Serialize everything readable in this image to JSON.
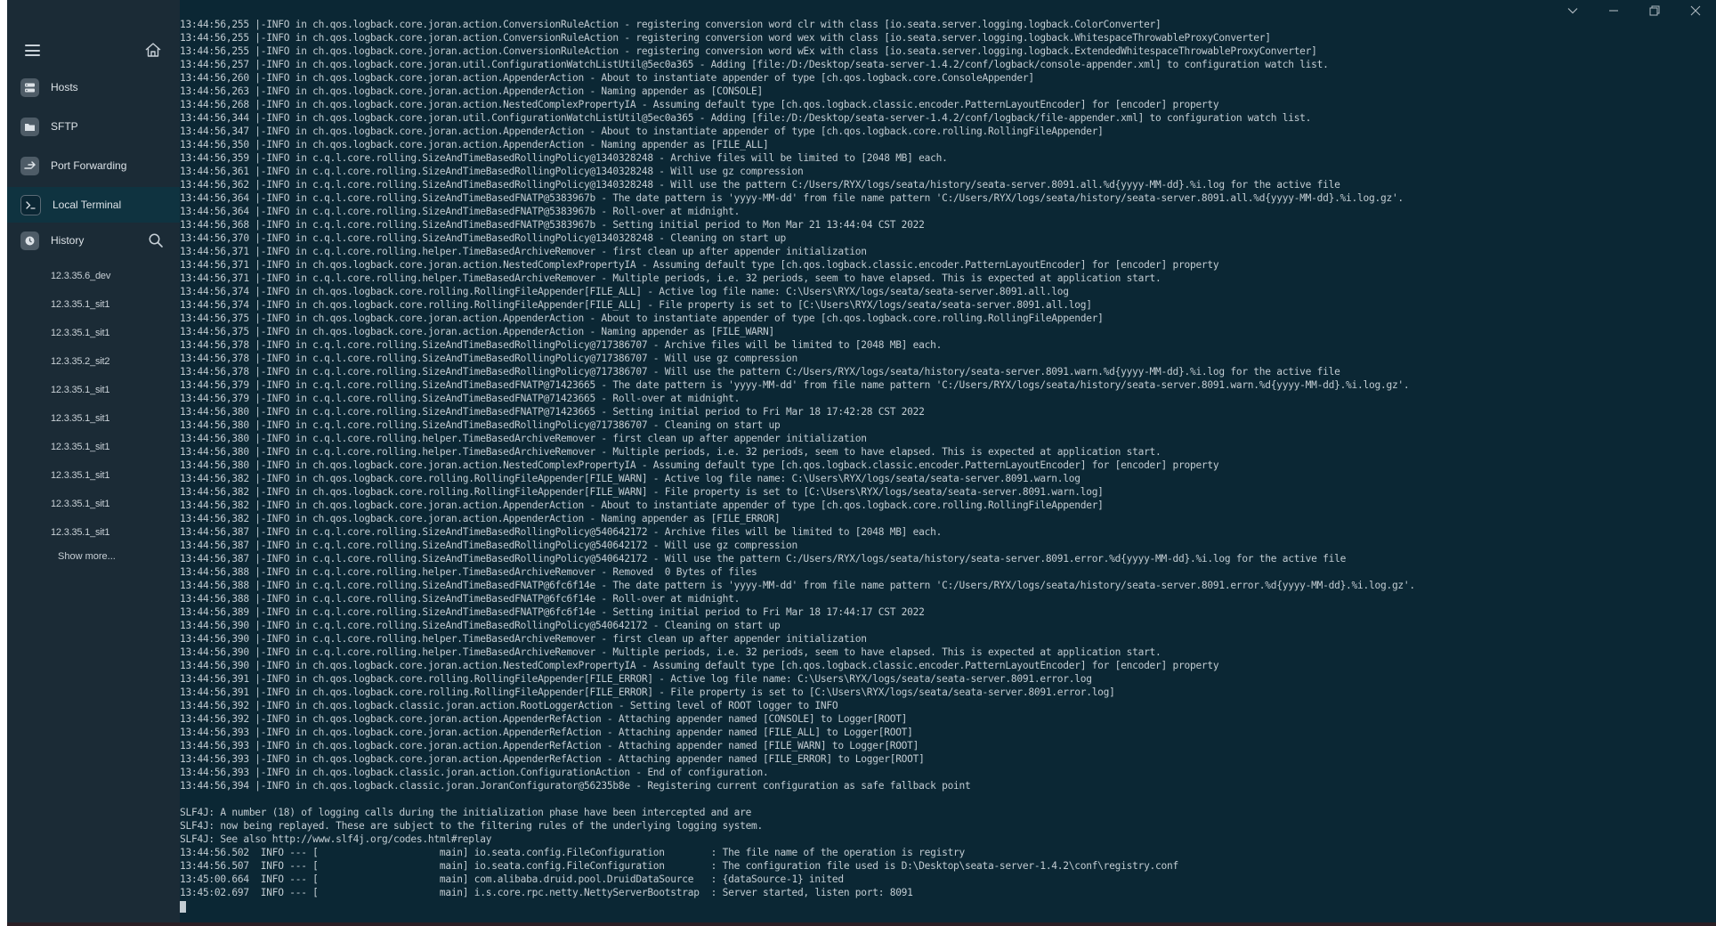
{
  "sidebar": {
    "nav": [
      {
        "label": "Hosts",
        "icon": "hosts-icon"
      },
      {
        "label": "SFTP",
        "icon": "sftp-icon"
      },
      {
        "label": "Port Forwarding",
        "icon": "port-forwarding-icon"
      },
      {
        "label": "Local Terminal",
        "icon": "terminal-icon"
      }
    ],
    "history_label": "History",
    "history": [
      "12.3.35.6_dev",
      "12.3.35.1_sit1",
      "12.3.35.1_sit1",
      "12.3.35.2_sit2",
      "12.3.35.1_sit1",
      "12.3.35.1_sit1",
      "12.3.35.1_sit1",
      "12.3.35.1_sit1",
      "12.3.35.1_sit1",
      "12.3.35.1_sit1"
    ],
    "show_more": "Show more..."
  },
  "window_controls": [
    "chevron-down-icon",
    "minimize-icon",
    "restore-icon",
    "close-icon"
  ],
  "terminal_lines": [
    "13:44:56,255 |-INFO in ch.qos.logback.core.joran.action.ConversionRuleAction - registering conversion word clr with class [io.seata.server.logging.logback.ColorConverter]",
    "13:44:56,255 |-INFO in ch.qos.logback.core.joran.action.ConversionRuleAction - registering conversion word wex with class [io.seata.server.logging.logback.WhitespaceThrowableProxyConverter]",
    "13:44:56,255 |-INFO in ch.qos.logback.core.joran.action.ConversionRuleAction - registering conversion word wEx with class [io.seata.server.logging.logback.ExtendedWhitespaceThrowableProxyConverter]",
    "13:44:56,257 |-INFO in ch.qos.logback.core.joran.util.ConfigurationWatchListUtil@5ec0a365 - Adding [file:/D:/Desktop/seata-server-1.4.2/conf/logback/console-appender.xml] to configuration watch list.",
    "13:44:56,260 |-INFO in ch.qos.logback.core.joran.action.AppenderAction - About to instantiate appender of type [ch.qos.logback.core.ConsoleAppender]",
    "13:44:56,263 |-INFO in ch.qos.logback.core.joran.action.AppenderAction - Naming appender as [CONSOLE]",
    "13:44:56,268 |-INFO in ch.qos.logback.core.joran.action.NestedComplexPropertyIA - Assuming default type [ch.qos.logback.classic.encoder.PatternLayoutEncoder] for [encoder] property",
    "13:44:56,344 |-INFO in ch.qos.logback.core.joran.util.ConfigurationWatchListUtil@5ec0a365 - Adding [file:/D:/Desktop/seata-server-1.4.2/conf/logback/file-appender.xml] to configuration watch list.",
    "13:44:56,347 |-INFO in ch.qos.logback.core.joran.action.AppenderAction - About to instantiate appender of type [ch.qos.logback.core.rolling.RollingFileAppender]",
    "13:44:56,350 |-INFO in ch.qos.logback.core.joran.action.AppenderAction - Naming appender as [FILE_ALL]",
    "13:44:56,359 |-INFO in c.q.l.core.rolling.SizeAndTimeBasedRollingPolicy@1340328248 - Archive files will be limited to [2048 MB] each.",
    "13:44:56,361 |-INFO in c.q.l.core.rolling.SizeAndTimeBasedRollingPolicy@1340328248 - Will use gz compression",
    "13:44:56,362 |-INFO in c.q.l.core.rolling.SizeAndTimeBasedRollingPolicy@1340328248 - Will use the pattern C:/Users/RYX/logs/seata/history/seata-server.8091.all.%d{yyyy-MM-dd}.%i.log for the active file",
    "13:44:56,364 |-INFO in c.q.l.core.rolling.SizeAndTimeBasedFNATP@5383967b - The date pattern is 'yyyy-MM-dd' from file name pattern 'C:/Users/RYX/logs/seata/history/seata-server.8091.all.%d{yyyy-MM-dd}.%i.log.gz'.",
    "13:44:56,364 |-INFO in c.q.l.core.rolling.SizeAndTimeBasedFNATP@5383967b - Roll-over at midnight.",
    "13:44:56,368 |-INFO in c.q.l.core.rolling.SizeAndTimeBasedFNATP@5383967b - Setting initial period to Mon Mar 21 13:44:04 CST 2022",
    "13:44:56,370 |-INFO in c.q.l.core.rolling.SizeAndTimeBasedRollingPolicy@1340328248 - Cleaning on start up",
    "13:44:56,371 |-INFO in c.q.l.core.rolling.helper.TimeBasedArchiveRemover - first clean up after appender initialization",
    "13:44:56,371 |-INFO in ch.qos.logback.core.joran.action.NestedComplexPropertyIA - Assuming default type [ch.qos.logback.classic.encoder.PatternLayoutEncoder] for [encoder] property",
    "13:44:56,371 |-INFO in c.q.l.core.rolling.helper.TimeBasedArchiveRemover - Multiple periods, i.e. 32 periods, seem to have elapsed. This is expected at application start.",
    "13:44:56,374 |-INFO in ch.qos.logback.core.rolling.RollingFileAppender[FILE_ALL] - Active log file name: C:\\Users\\RYX/logs/seata/seata-server.8091.all.log",
    "13:44:56,374 |-INFO in ch.qos.logback.core.rolling.RollingFileAppender[FILE_ALL] - File property is set to [C:\\Users\\RYX/logs/seata/seata-server.8091.all.log]",
    "13:44:56,375 |-INFO in ch.qos.logback.core.joran.action.AppenderAction - About to instantiate appender of type [ch.qos.logback.core.rolling.RollingFileAppender]",
    "13:44:56,375 |-INFO in ch.qos.logback.core.joran.action.AppenderAction - Naming appender as [FILE_WARN]",
    "13:44:56,378 |-INFO in c.q.l.core.rolling.SizeAndTimeBasedRollingPolicy@717386707 - Archive files will be limited to [2048 MB] each.",
    "13:44:56,378 |-INFO in c.q.l.core.rolling.SizeAndTimeBasedRollingPolicy@717386707 - Will use gz compression",
    "13:44:56,378 |-INFO in c.q.l.core.rolling.SizeAndTimeBasedRollingPolicy@717386707 - Will use the pattern C:/Users/RYX/logs/seata/history/seata-server.8091.warn.%d{yyyy-MM-dd}.%i.log for the active file",
    "13:44:56,379 |-INFO in c.q.l.core.rolling.SizeAndTimeBasedFNATP@71423665 - The date pattern is 'yyyy-MM-dd' from file name pattern 'C:/Users/RYX/logs/seata/history/seata-server.8091.warn.%d{yyyy-MM-dd}.%i.log.gz'.",
    "13:44:56,379 |-INFO in c.q.l.core.rolling.SizeAndTimeBasedFNATP@71423665 - Roll-over at midnight.",
    "13:44:56,380 |-INFO in c.q.l.core.rolling.SizeAndTimeBasedFNATP@71423665 - Setting initial period to Fri Mar 18 17:42:28 CST 2022",
    "13:44:56,380 |-INFO in c.q.l.core.rolling.SizeAndTimeBasedRollingPolicy@717386707 - Cleaning on start up",
    "13:44:56,380 |-INFO in c.q.l.core.rolling.helper.TimeBasedArchiveRemover - first clean up after appender initialization",
    "13:44:56,380 |-INFO in c.q.l.core.rolling.helper.TimeBasedArchiveRemover - Multiple periods, i.e. 32 periods, seem to have elapsed. This is expected at application start.",
    "13:44:56,380 |-INFO in ch.qos.logback.core.joran.action.NestedComplexPropertyIA - Assuming default type [ch.qos.logback.classic.encoder.PatternLayoutEncoder] for [encoder] property",
    "13:44:56,382 |-INFO in ch.qos.logback.core.rolling.RollingFileAppender[FILE_WARN] - Active log file name: C:\\Users\\RYX/logs/seata/seata-server.8091.warn.log",
    "13:44:56,382 |-INFO in ch.qos.logback.core.rolling.RollingFileAppender[FILE_WARN] - File property is set to [C:\\Users\\RYX/logs/seata/seata-server.8091.warn.log]",
    "13:44:56,382 |-INFO in ch.qos.logback.core.joran.action.AppenderAction - About to instantiate appender of type [ch.qos.logback.core.rolling.RollingFileAppender]",
    "13:44:56,382 |-INFO in ch.qos.logback.core.joran.action.AppenderAction - Naming appender as [FILE_ERROR]",
    "13:44:56,387 |-INFO in c.q.l.core.rolling.SizeAndTimeBasedRollingPolicy@540642172 - Archive files will be limited to [2048 MB] each.",
    "13:44:56,387 |-INFO in c.q.l.core.rolling.SizeAndTimeBasedRollingPolicy@540642172 - Will use gz compression",
    "13:44:56,387 |-INFO in c.q.l.core.rolling.SizeAndTimeBasedRollingPolicy@540642172 - Will use the pattern C:/Users/RYX/logs/seata/history/seata-server.8091.error.%d{yyyy-MM-dd}.%i.log for the active file",
    "13:44:56,388 |-INFO in c.q.l.core.rolling.helper.TimeBasedArchiveRemover - Removed  0 Bytes of files",
    "13:44:56,388 |-INFO in c.q.l.core.rolling.SizeAndTimeBasedFNATP@6fc6f14e - The date pattern is 'yyyy-MM-dd' from file name pattern 'C:/Users/RYX/logs/seata/history/seata-server.8091.error.%d{yyyy-MM-dd}.%i.log.gz'.",
    "13:44:56,388 |-INFO in c.q.l.core.rolling.SizeAndTimeBasedFNATP@6fc6f14e - Roll-over at midnight.",
    "13:44:56,389 |-INFO in c.q.l.core.rolling.SizeAndTimeBasedFNATP@6fc6f14e - Setting initial period to Fri Mar 18 17:44:17 CST 2022",
    "13:44:56,390 |-INFO in c.q.l.core.rolling.SizeAndTimeBasedRollingPolicy@540642172 - Cleaning on start up",
    "13:44:56,390 |-INFO in c.q.l.core.rolling.helper.TimeBasedArchiveRemover - first clean up after appender initialization",
    "13:44:56,390 |-INFO in c.q.l.core.rolling.helper.TimeBasedArchiveRemover - Multiple periods, i.e. 32 periods, seem to have elapsed. This is expected at application start.",
    "13:44:56,390 |-INFO in ch.qos.logback.core.joran.action.NestedComplexPropertyIA - Assuming default type [ch.qos.logback.classic.encoder.PatternLayoutEncoder] for [encoder] property",
    "13:44:56,391 |-INFO in ch.qos.logback.core.rolling.RollingFileAppender[FILE_ERROR] - Active log file name: C:\\Users\\RYX/logs/seata/seata-server.8091.error.log",
    "13:44:56,391 |-INFO in ch.qos.logback.core.rolling.RollingFileAppender[FILE_ERROR] - File property is set to [C:\\Users\\RYX/logs/seata/seata-server.8091.error.log]",
    "13:44:56,392 |-INFO in ch.qos.logback.classic.joran.action.RootLoggerAction - Setting level of ROOT logger to INFO",
    "13:44:56,392 |-INFO in ch.qos.logback.core.joran.action.AppenderRefAction - Attaching appender named [CONSOLE] to Logger[ROOT]",
    "13:44:56,393 |-INFO in ch.qos.logback.core.joran.action.AppenderRefAction - Attaching appender named [FILE_ALL] to Logger[ROOT]",
    "13:44:56,393 |-INFO in ch.qos.logback.core.joran.action.AppenderRefAction - Attaching appender named [FILE_WARN] to Logger[ROOT]",
    "13:44:56,393 |-INFO in ch.qos.logback.core.joran.action.AppenderRefAction - Attaching appender named [FILE_ERROR] to Logger[ROOT]",
    "13:44:56,393 |-INFO in ch.qos.logback.classic.joran.action.ConfigurationAction - End of configuration.",
    "13:44:56,394 |-INFO in ch.qos.logback.classic.joran.JoranConfigurator@56235b8e - Registering current configuration as safe fallback point",
    "",
    "SLF4J: A number (18) of logging calls during the initialization phase have been intercepted and are",
    "SLF4J: now being replayed. These are subject to the filtering rules of the underlying logging system.",
    "SLF4J: See also http://www.slf4j.org/codes.html#replay",
    "13:44:56.502  INFO --- [                     main] io.seata.config.FileConfiguration        : The file name of the operation is registry",
    "13:44:56.507  INFO --- [                     main] io.seata.config.FileConfiguration        : The configuration file used is D:\\Desktop\\seata-server-1.4.2\\conf\\registry.conf",
    "13:45:00.664  INFO --- [                     main] com.alibaba.druid.pool.DruidDataSource   : {dataSource-1} inited",
    "13:45:02.697  INFO --- [                     main] i.s.core.rpc.netty.NettyServerBootstrap  : Server started, listen port: 8091"
  ]
}
